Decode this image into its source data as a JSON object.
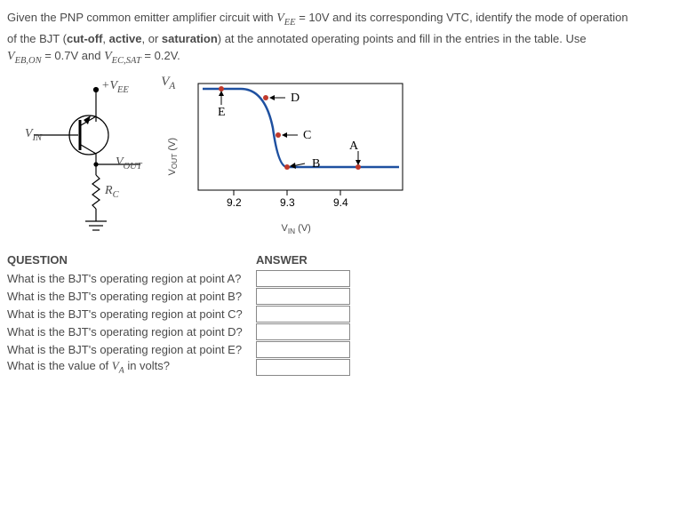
{
  "prompt": {
    "line1a": "Given the PNP common emitter amplifier circuit with ",
    "vee_sym": "V",
    "vee_sub": "EE",
    "vee_val": " = 10V",
    "line1b": " and its corresponding VTC, identify the mode of operation",
    "line2a": "of the BJT (",
    "cutoff": "cut-off",
    "sep1": ", ",
    "active": "active",
    "sep2": ", or ",
    "sat": "saturation",
    "line2b": ") at the annotated operating points and fill in the entries in the table. Use",
    "vebon_sym": "V",
    "vebon_sub": "EB,ON",
    "vebon_val": " = 0.7V",
    "and": " and ",
    "vecsat_sym": "V",
    "vecsat_sub": "EC,SAT",
    "vecsat_val": " = 0.2V."
  },
  "circuit": {
    "vee_plus": "+V",
    "vee_sub": "EE",
    "vin": "V",
    "vin_sub": "IN",
    "vout": "V",
    "vout_sub": "OUT",
    "rc": "R",
    "rc_sub": "C"
  },
  "vtc": {
    "ylabel_v": "V",
    "ylabel_sub": "OUT",
    "ylabel_unit": " (V)",
    "va": "V",
    "va_sub": "A",
    "ticks": [
      "9.2",
      "9.3",
      "9.4"
    ],
    "xlabel_v": "V",
    "xlabel_sub": "IN",
    "xlabel_unit": " (V)",
    "labels": {
      "A": "A",
      "B": "B",
      "C": "C",
      "D": "D",
      "E": "E"
    },
    "arrow_up": "↑",
    "arrow_down": "↓",
    "arrow_left": "←"
  },
  "table": {
    "head_q": "QUESTION",
    "head_a": "ANSWER",
    "rows": [
      "What is the BJT's operating region at point A?",
      "What is the BJT's operating region at point B?",
      "What is the BJT's operating region at point C?",
      "What is the BJT's operating region at point D?",
      "What is the BJT's operating region at point E?"
    ],
    "row_va_a": "What is the value of ",
    "row_va_sym": "V",
    "row_va_sub": "A",
    "row_va_b": " in volts?"
  }
}
